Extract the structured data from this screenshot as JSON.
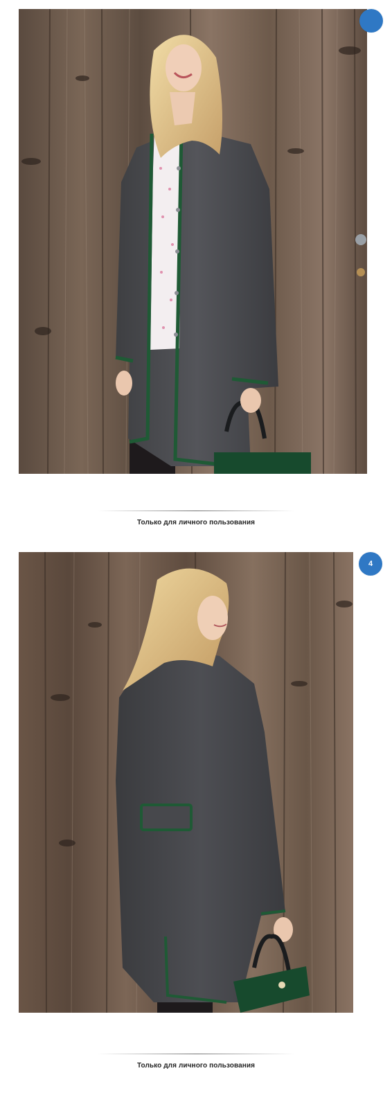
{
  "pages": [
    {
      "badge_number": "",
      "caption": "Только для личного пользования",
      "photo_subject": "woman-front-grey-cardigan"
    },
    {
      "badge_number": "4",
      "caption": "Только для личного пользования",
      "photo_subject": "woman-back-grey-cardigan"
    }
  ],
  "colors": {
    "badge": "#2f78c4",
    "wood": "#6b5748",
    "cardigan": "#47484b",
    "trim": "#1f5a35"
  }
}
